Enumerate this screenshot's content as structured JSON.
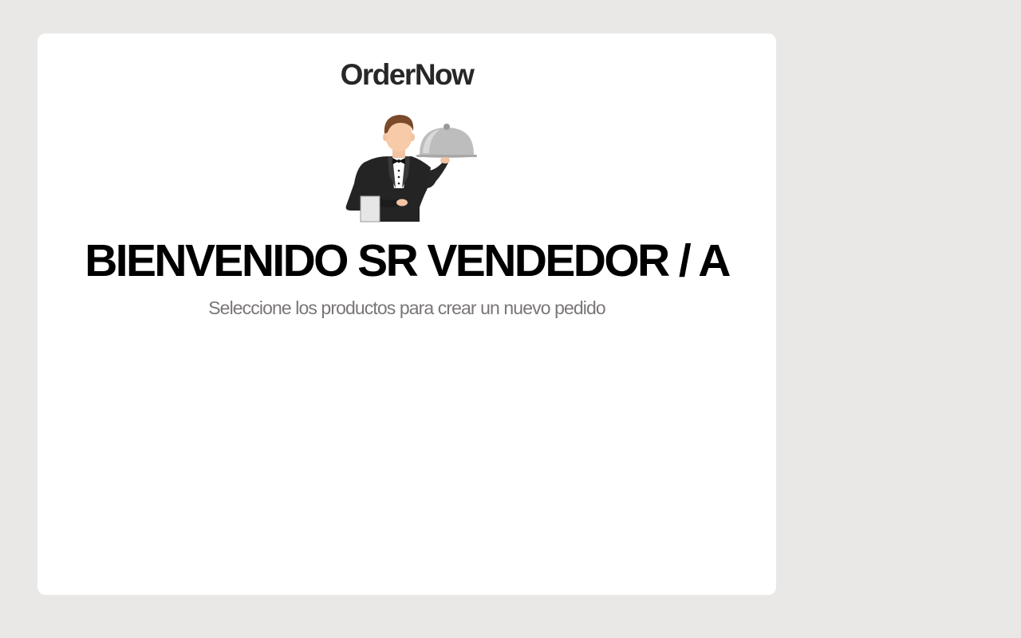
{
  "brand": {
    "name": "OrderNow"
  },
  "hero": {
    "illustration": "waiter-with-cloche-icon",
    "title": "BIENVENIDO SR VENDEDOR / A",
    "subtitle": "Seleccione los productos para crear un nuevo pedido"
  },
  "colors": {
    "background": "#e9e8e6",
    "card": "#ffffff",
    "title": "#000000",
    "subtitle": "#7a7676",
    "logo": "#272727"
  }
}
